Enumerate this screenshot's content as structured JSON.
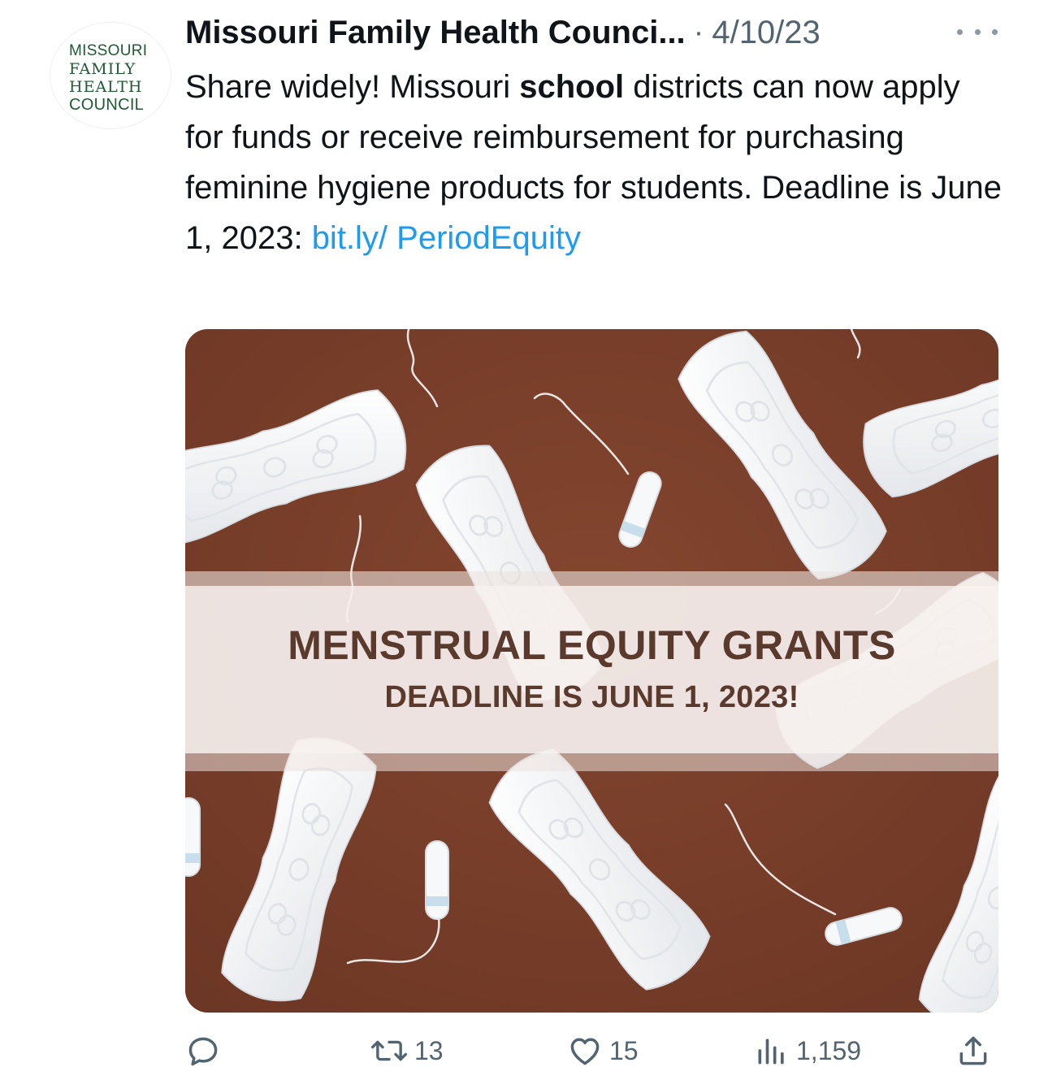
{
  "tweet": {
    "author": {
      "display_name": "Missouri Family Health Counci...",
      "avatar_logo_lines": [
        "MISSOURI",
        "FAMILY",
        "HEALTH",
        "COUNCIL"
      ]
    },
    "separator": "·",
    "date": "4/10/23",
    "more_icon": "more-horizontal-icon",
    "text": {
      "part1": "Share widely! Missouri ",
      "bold": "school",
      "part2": " districts can now apply for funds or receive reimbursement for purchasing feminine hygiene products for students. Deadline is June 1, 2023: ",
      "link": "bit.ly/ PeriodEquity"
    },
    "media": {
      "headline": "MENSTRUAL EQUITY GRANTS",
      "subline": "DEADLINE IS JUNE 1, 2023!",
      "background_color": "#7a3f2c"
    },
    "actions": {
      "reply": {
        "icon": "reply-icon"
      },
      "retweet": {
        "icon": "retweet-icon",
        "count": "13"
      },
      "like": {
        "icon": "heart-icon",
        "count": "15"
      },
      "views": {
        "icon": "views-icon",
        "count": "1,159"
      },
      "share": {
        "icon": "share-icon"
      }
    }
  }
}
